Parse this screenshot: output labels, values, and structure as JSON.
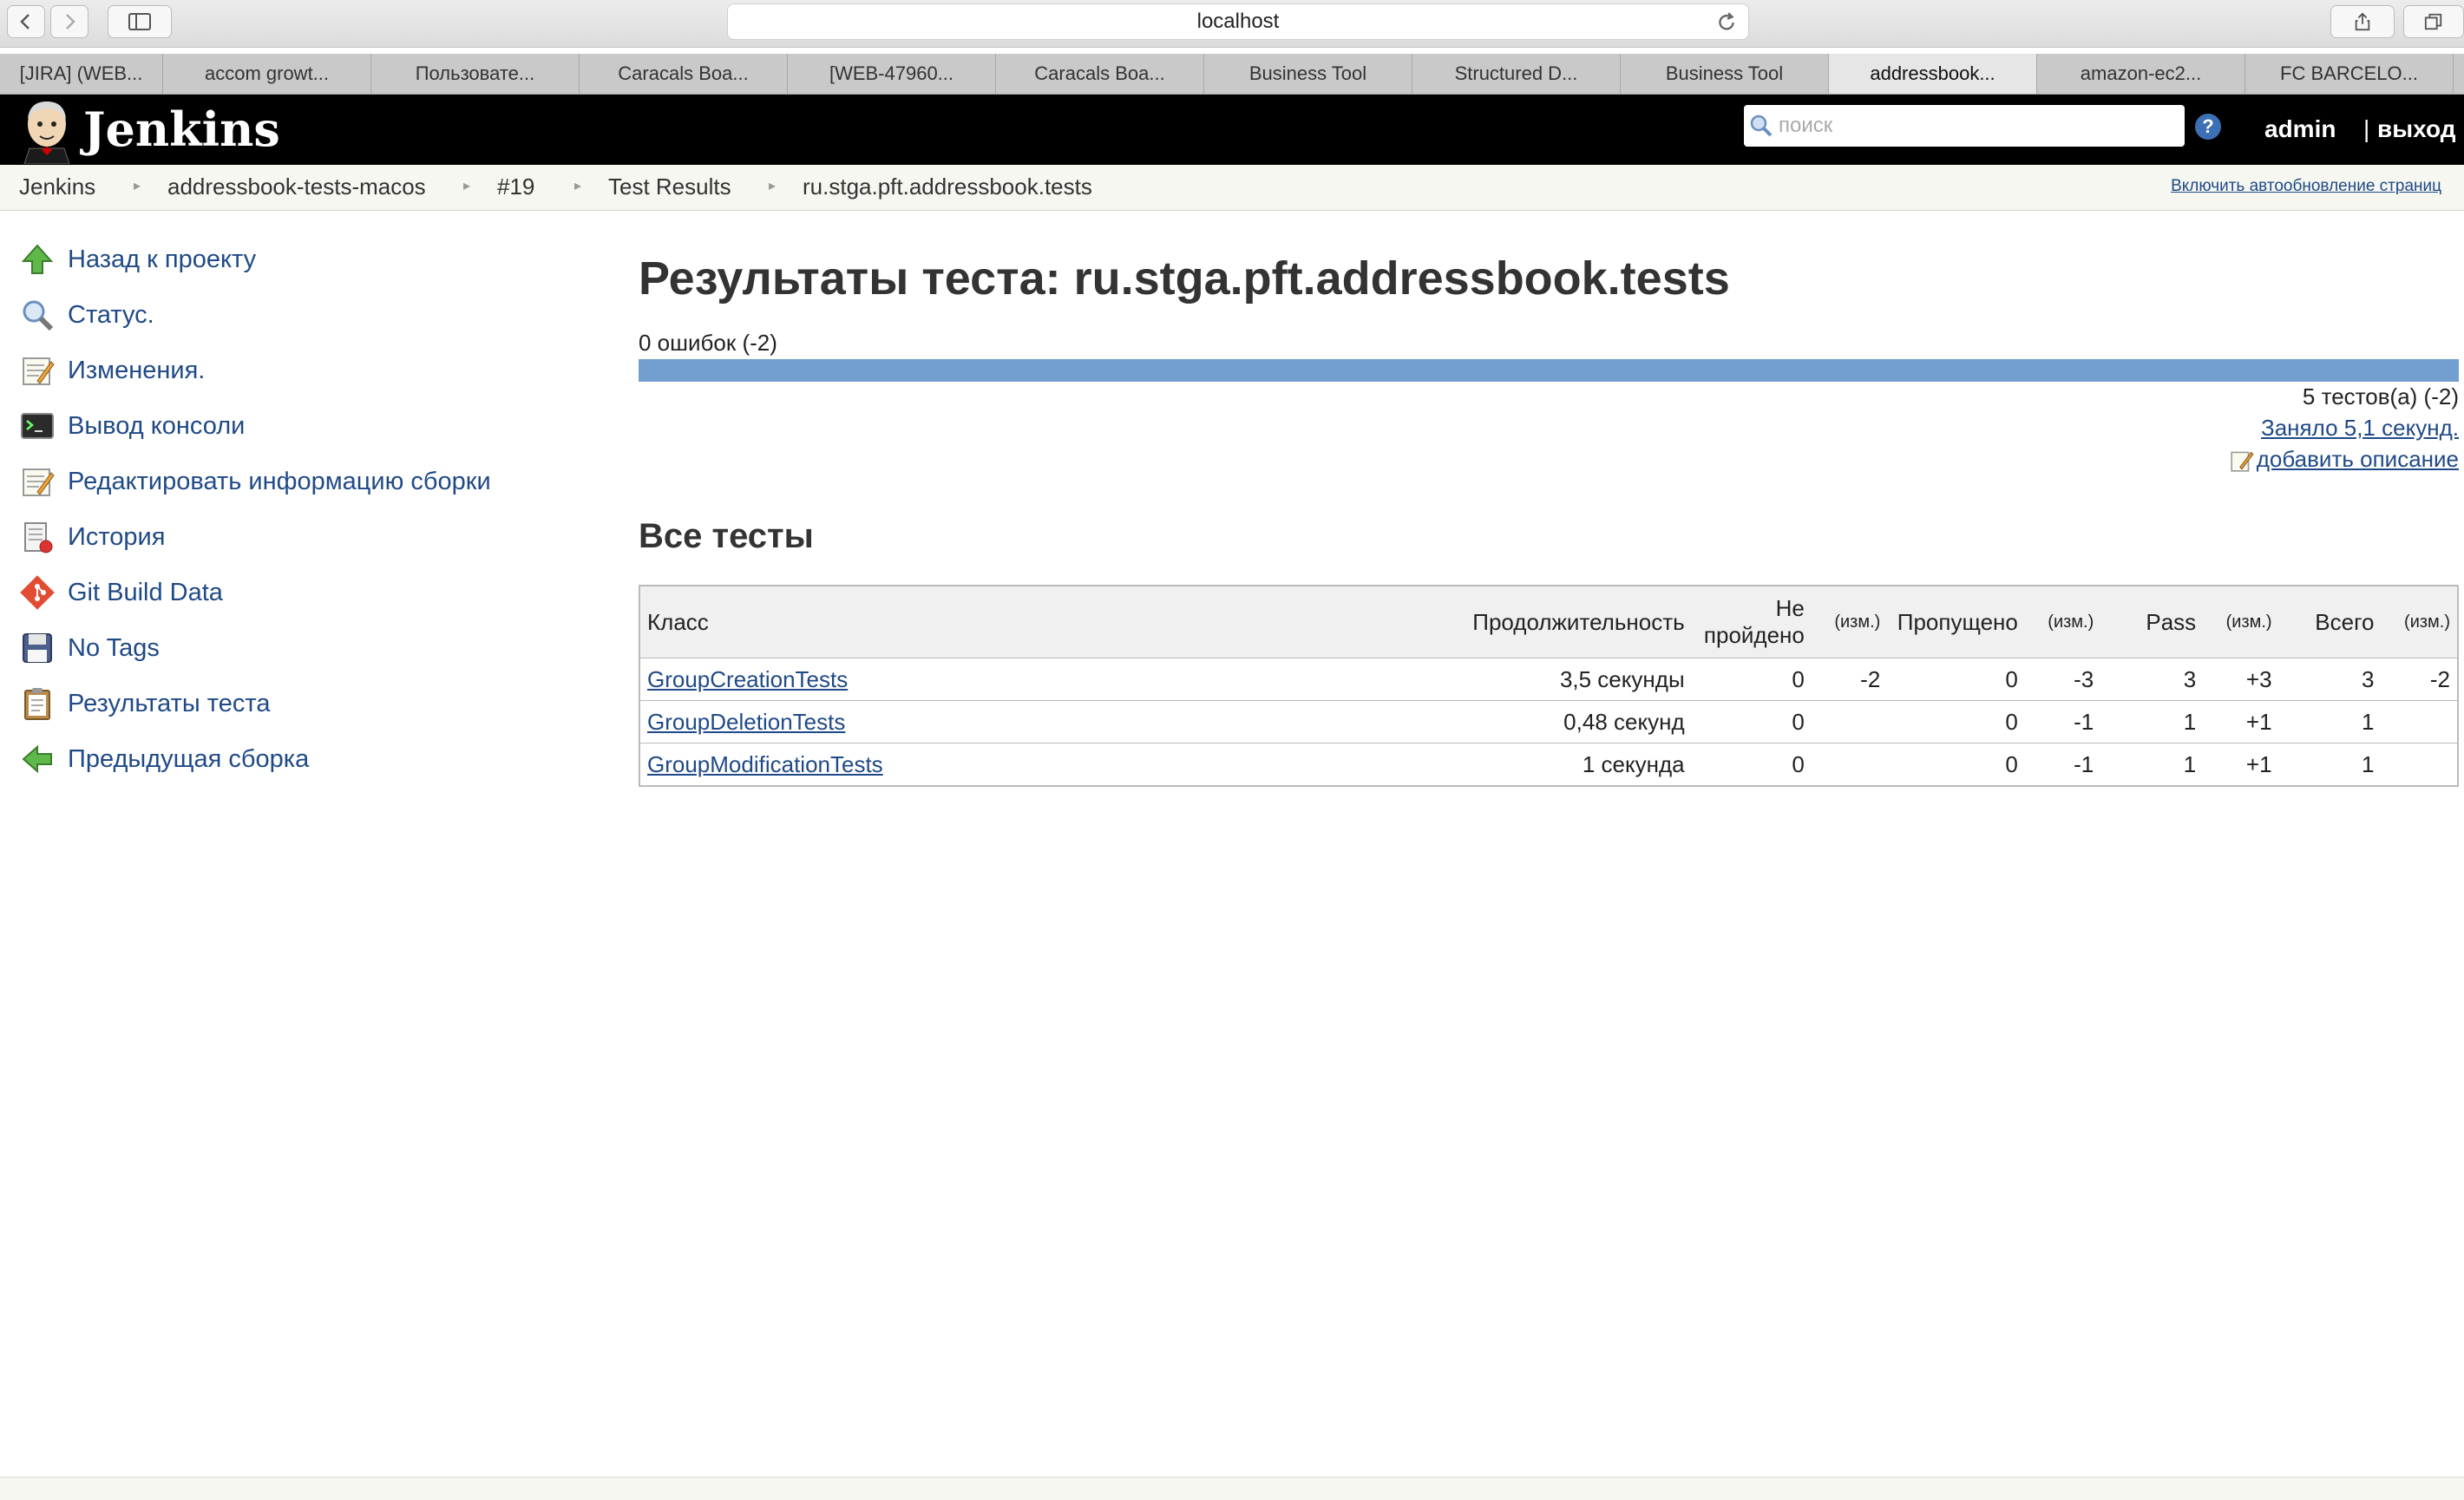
{
  "browser": {
    "url": "localhost",
    "tabs": [
      {
        "label": "[JIRA] (WEB..."
      },
      {
        "label": "accom growt..."
      },
      {
        "label": "Пользовате..."
      },
      {
        "label": "Caracals Boa..."
      },
      {
        "label": "[WEB-47960..."
      },
      {
        "label": "Caracals Boa..."
      },
      {
        "label": "Business Tool"
      },
      {
        "label": "Structured D..."
      },
      {
        "label": "Business Tool"
      },
      {
        "label": "addressbook...",
        "active": true
      },
      {
        "label": "amazon-ec2..."
      },
      {
        "label": "FC BARCELO..."
      }
    ]
  },
  "header": {
    "title": "Jenkins",
    "search_placeholder": "поиск",
    "help": "?",
    "user": "admin",
    "separator": "|",
    "logout": "выход"
  },
  "breadcrumb": {
    "items": [
      "Jenkins",
      "addressbook-tests-macos",
      "#19",
      "Test Results",
      "ru.stga.pft.addressbook.tests"
    ],
    "autorefresh": "Включить автообновление страниц"
  },
  "sidebar": {
    "items": [
      {
        "label": "Назад к проекту",
        "icon": "up-arrow-icon"
      },
      {
        "label": "Статус.",
        "icon": "magnifier-icon"
      },
      {
        "label": "Изменения.",
        "icon": "notepad-icon"
      },
      {
        "label": "Вывод консоли",
        "icon": "terminal-icon"
      },
      {
        "label": "Редактировать информацию сборки",
        "icon": "notepad-icon"
      },
      {
        "label": "История",
        "icon": "history-icon"
      },
      {
        "label": "Git Build Data",
        "icon": "git-icon"
      },
      {
        "label": "No Tags",
        "icon": "floppy-icon"
      },
      {
        "label": "Результаты теста",
        "icon": "clipboard-icon"
      },
      {
        "label": "Предыдущая сборка",
        "icon": "left-arrow-icon"
      }
    ]
  },
  "main": {
    "title": "Результаты теста: ru.stga.pft.addressbook.tests",
    "failures": "0 ошибок (-2)",
    "pass_fraction": 1.0,
    "bar_color": "#729fcf",
    "test_count": "5 тестов(а) (-2)",
    "took": "Заняло 5,1 секунд.",
    "add_description": "добавить описание",
    "all_tests_heading": "Все тесты",
    "table": {
      "headers": {
        "class": "Класс",
        "duration": "Продолжительность",
        "failed_line1": "Не",
        "failed_line2": "пройдено",
        "change": "(изм.)",
        "skipped": "Пропущено",
        "pass": "Pass",
        "total": "Всего"
      },
      "rows": [
        {
          "class": "GroupCreationTests",
          "duration": "3,5 секунды",
          "failed": "0",
          "failed_diff": "-2",
          "skipped": "0",
          "skipped_diff": "-3",
          "pass": "3",
          "pass_diff": "+3",
          "total": "3",
          "total_diff": "-2"
        },
        {
          "class": "GroupDeletionTests",
          "duration": "0,48 секунд",
          "failed": "0",
          "failed_diff": "",
          "skipped": "0",
          "skipped_diff": "-1",
          "pass": "1",
          "pass_diff": "+1",
          "total": "1",
          "total_diff": ""
        },
        {
          "class": "GroupModificationTests",
          "duration": "1 секунда",
          "failed": "0",
          "failed_diff": "",
          "skipped": "0",
          "skipped_diff": "-1",
          "pass": "1",
          "pass_diff": "+1",
          "total": "1",
          "total_diff": ""
        }
      ]
    }
  }
}
